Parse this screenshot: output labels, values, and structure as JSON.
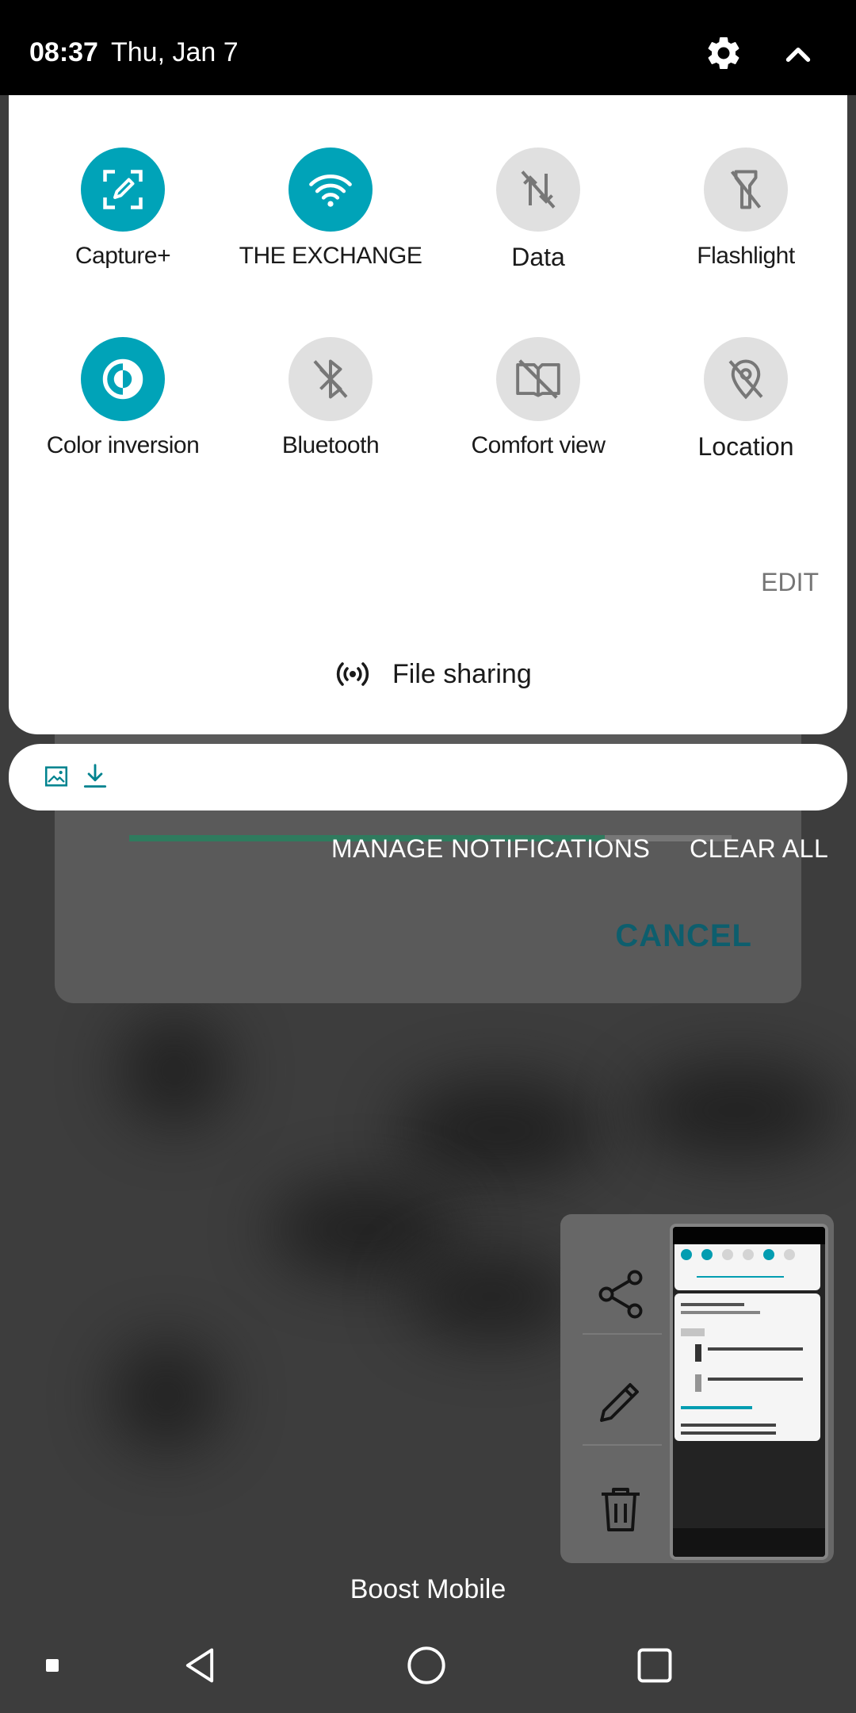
{
  "status_bar": {
    "time": "08:37",
    "date": "Thu, Jan 7",
    "settings_icon": "gear-icon",
    "collapse_icon": "chevron-up-icon"
  },
  "quick_settings": {
    "tiles": [
      {
        "label": "Capture+",
        "icon": "capture-icon",
        "state": "on"
      },
      {
        "label": "THE EXCHANGE",
        "icon": "wifi-icon",
        "state": "on"
      },
      {
        "label": "Data",
        "icon": "data-off-icon",
        "state": "off"
      },
      {
        "label": "Flashlight",
        "icon": "flashlight-off-icon",
        "state": "off"
      },
      {
        "label": "Color inversion",
        "icon": "color-inversion-icon",
        "state": "on"
      },
      {
        "label": "Bluetooth",
        "icon": "bluetooth-off-icon",
        "state": "off"
      },
      {
        "label": "Comfort view",
        "icon": "comfort-view-off-icon",
        "state": "off"
      },
      {
        "label": "Location",
        "icon": "location-off-icon",
        "state": "off"
      }
    ],
    "edit_label": "EDIT",
    "file_sharing_label": "File sharing"
  },
  "notifications": {
    "manage_label": "MANAGE NOTIFICATIONS",
    "clear_all_label": "CLEAR ALL"
  },
  "background_dialog": {
    "cancel_label": "CANCEL",
    "progress": 0.79
  },
  "carrier": "Boost Mobile",
  "colors": {
    "accent": "#00a3b8",
    "tile_off": "#e0e0e0",
    "notification_icon": "#00838f"
  }
}
